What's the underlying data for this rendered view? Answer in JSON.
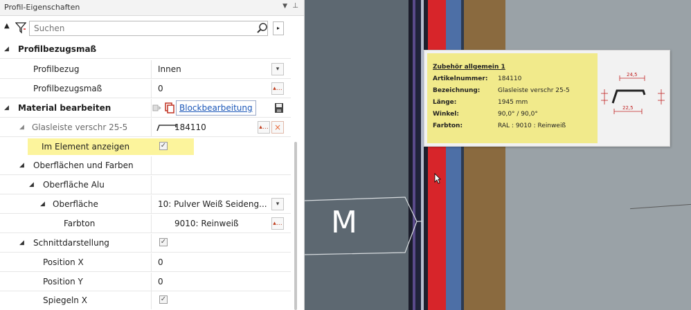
{
  "panel": {
    "title": "Profil-Eigenschaften",
    "search_placeholder": "Suchen"
  },
  "rows": {
    "profilbezugsmass_header": "Profilbezugsmaß",
    "profilbezug_label": "Profilbezug",
    "profilbezug_value": "Innen",
    "profilbezugsmass_label": "Profilbezugsmaß",
    "profilbezugsmass_value": "0",
    "material_header": "Material bearbeiten",
    "blockbearbeitung_link": "Blockbearbeitung",
    "glasleiste_label": "Glasleiste verschr 25-5",
    "glasleiste_value": "184110",
    "im_element_label": "Im Element anzeigen",
    "oberflaechen_label": "Oberflächen und Farben",
    "oberflaeche_alu_label": "Oberfläche Alu",
    "oberflaeche_label": "Oberfläche",
    "oberflaeche_value": "10: Pulver Weiß Seideng...",
    "farbton_label": "Farbton",
    "farbton_value": "9010: Reinweiß",
    "schnitt_label": "Schnittdarstellung",
    "position_x_label": "Position X",
    "position_x_value": "0",
    "position_y_label": "Position Y",
    "position_y_value": "0",
    "spiegeln_x_label": "Spiegeln X"
  },
  "viewport": {
    "marker_letter": "M"
  },
  "tooltip": {
    "title": "Zubehör allgemein 1",
    "fields": [
      {
        "key": "Artikelnummer:",
        "value": "184110"
      },
      {
        "key": "Bezeichnung:",
        "value": "Glasleiste verschr 25-5"
      },
      {
        "key": "Länge:",
        "value": "1945 mm"
      },
      {
        "key": "Winkel:",
        "value": "90,0° / 90,0°"
      },
      {
        "key": "Farbton:",
        "value": "RAL : 9010 : Reinweiß"
      }
    ],
    "dim_top": "24,5",
    "dim_bottom": "22,5"
  },
  "colors": {
    "highlight": "#fcf49c",
    "tooltip_yellow": "#f1ea8b",
    "profile_red": "#d7252a",
    "profile_blue": "#4d6fa6",
    "profile_brown": "#8a6a3f",
    "link_blue": "#1a56b8"
  }
}
